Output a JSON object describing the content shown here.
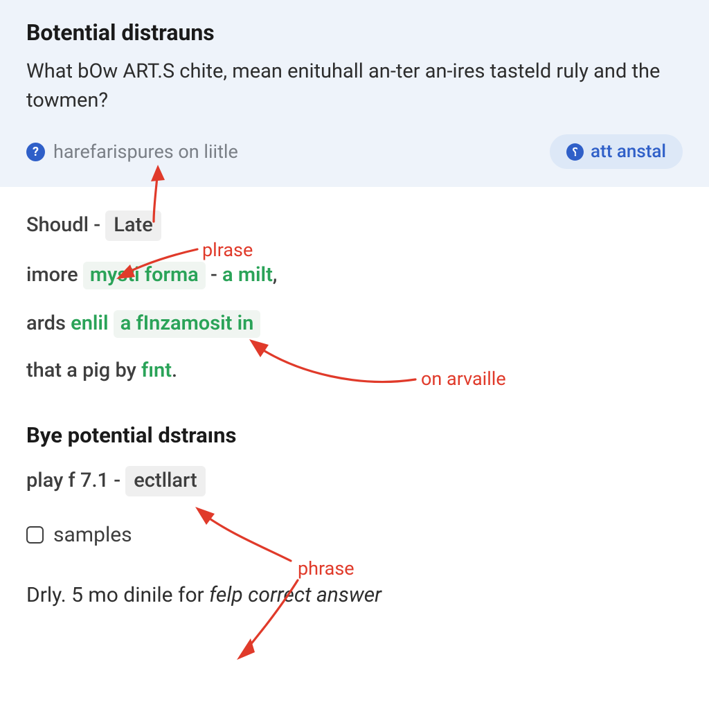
{
  "box": {
    "title": "Botential distrauns",
    "question": "What bOw ART.S chite, mean enituhall an-ter an-ires tasteld ruly and the towmen?",
    "hint_label": "harefarispures on liitle",
    "button_label": "att anstal"
  },
  "body": {
    "line1_a": "Shoudl - ",
    "line1_card": "Late",
    "line2_a": "imore ",
    "line2_hl": "mysti forma",
    "line2_b": " - ",
    "line2_c": "a milt",
    "line2_d": ",",
    "line3_a": "ards ",
    "line3_g1": "enlil",
    "line3_sp": " ",
    "line3_hl": "a fInzamosit in",
    "line4_a": "that a pig by ",
    "line4_g": "fınt",
    "line4_b": "."
  },
  "sec2": {
    "heading": "Bye potential dstraıns",
    "play_a": "play f 7.1 - ",
    "play_card": "eсtllart",
    "samples": "samples",
    "final_a": "Drly. 5 mo dinile for ",
    "final_it": "felp correct answer"
  },
  "annotations": {
    "plrase": "plrase",
    "on_arvaille": "on arvaille",
    "phrase": "phrase"
  }
}
